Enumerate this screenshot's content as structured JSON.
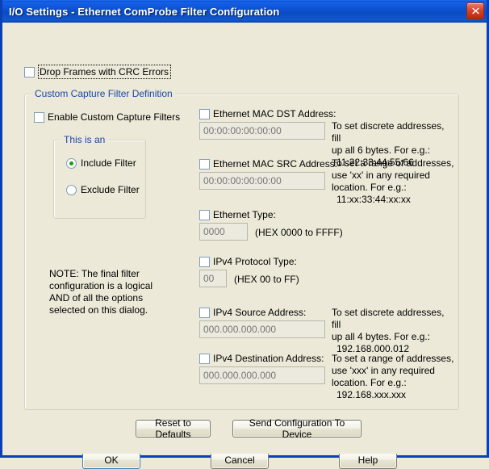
{
  "window": {
    "title": "I/O Settings - Ethernet ComProbe Filter Configuration",
    "close_icon": "close-icon",
    "accent_color": "#0a3fb5",
    "background_color": "#ece9d8",
    "legend_color": "#1b49a6"
  },
  "drop_frames": {
    "label": "Drop Frames with CRC Errors",
    "checked": false,
    "focused": true
  },
  "custom_filter_group": {
    "legend": "Custom Capture Filter Definition",
    "enable": {
      "label": "Enable Custom Capture Filters",
      "checked": false
    }
  },
  "filter_direction_group": {
    "legend": "This is an",
    "options": [
      {
        "label": "Include Filter",
        "selected": true
      },
      {
        "label": "Exclude Filter",
        "selected": false
      }
    ],
    "selected_dot_color": "#16a016"
  },
  "note": {
    "lines": [
      "NOTE: The final filter",
      "configuration is a logical",
      "AND of all the options",
      "selected on this dialog."
    ]
  },
  "fields": [
    {
      "id": "ethernet-mac-dst",
      "label": "Ethernet MAC DST Address:",
      "checked": false,
      "value": "",
      "placeholder": "00:00:00:00:00:00",
      "hint_lines": [
        "To set discrete addresses, fill",
        "up all 6 bytes. For e.g.:",
        "11:22:33:44:55:66"
      ]
    },
    {
      "id": "ethernet-mac-src",
      "label": "Ethernet MAC SRC Address:",
      "checked": false,
      "value": "",
      "placeholder": "00:00:00:00:00:00",
      "hint_lines": [
        "To set a range of addresses,",
        "use 'xx' in any required",
        "location. For e.g.:",
        "11:xx:33:44:xx:xx"
      ]
    },
    {
      "id": "ethernet-type",
      "label": "Ethernet Type:",
      "checked": false,
      "value": "",
      "placeholder": "0000",
      "suffix": "(HEX 0000 to FFFF)"
    },
    {
      "id": "ipv4-protocol-type",
      "label": "IPv4 Protocol Type:",
      "checked": false,
      "value": "",
      "placeholder": "00",
      "suffix": "(HEX 00 to FF)"
    },
    {
      "id": "ipv4-source-address",
      "label": "IPv4 Source Address:",
      "checked": false,
      "value": "",
      "placeholder": "000.000.000.000",
      "hint_lines": [
        "To set discrete addresses, fill",
        "up all 4 bytes. For e.g.:",
        "192.168.000.012"
      ]
    },
    {
      "id": "ipv4-destination-address",
      "label": "IPv4 Destination Address:",
      "checked": false,
      "value": "",
      "placeholder": "000.000.000.000",
      "hint_lines": [
        "To set a range of addresses,",
        "use 'xxx' in any required",
        "location. For e.g.:",
        "192.168.xxx.xxx"
      ]
    }
  ],
  "action_buttons": {
    "reset": "Reset to Defaults",
    "send": "Send Configuration To Device"
  },
  "dialog_buttons": {
    "ok": "OK",
    "cancel": "Cancel",
    "help": "Help",
    "default": "OK"
  }
}
